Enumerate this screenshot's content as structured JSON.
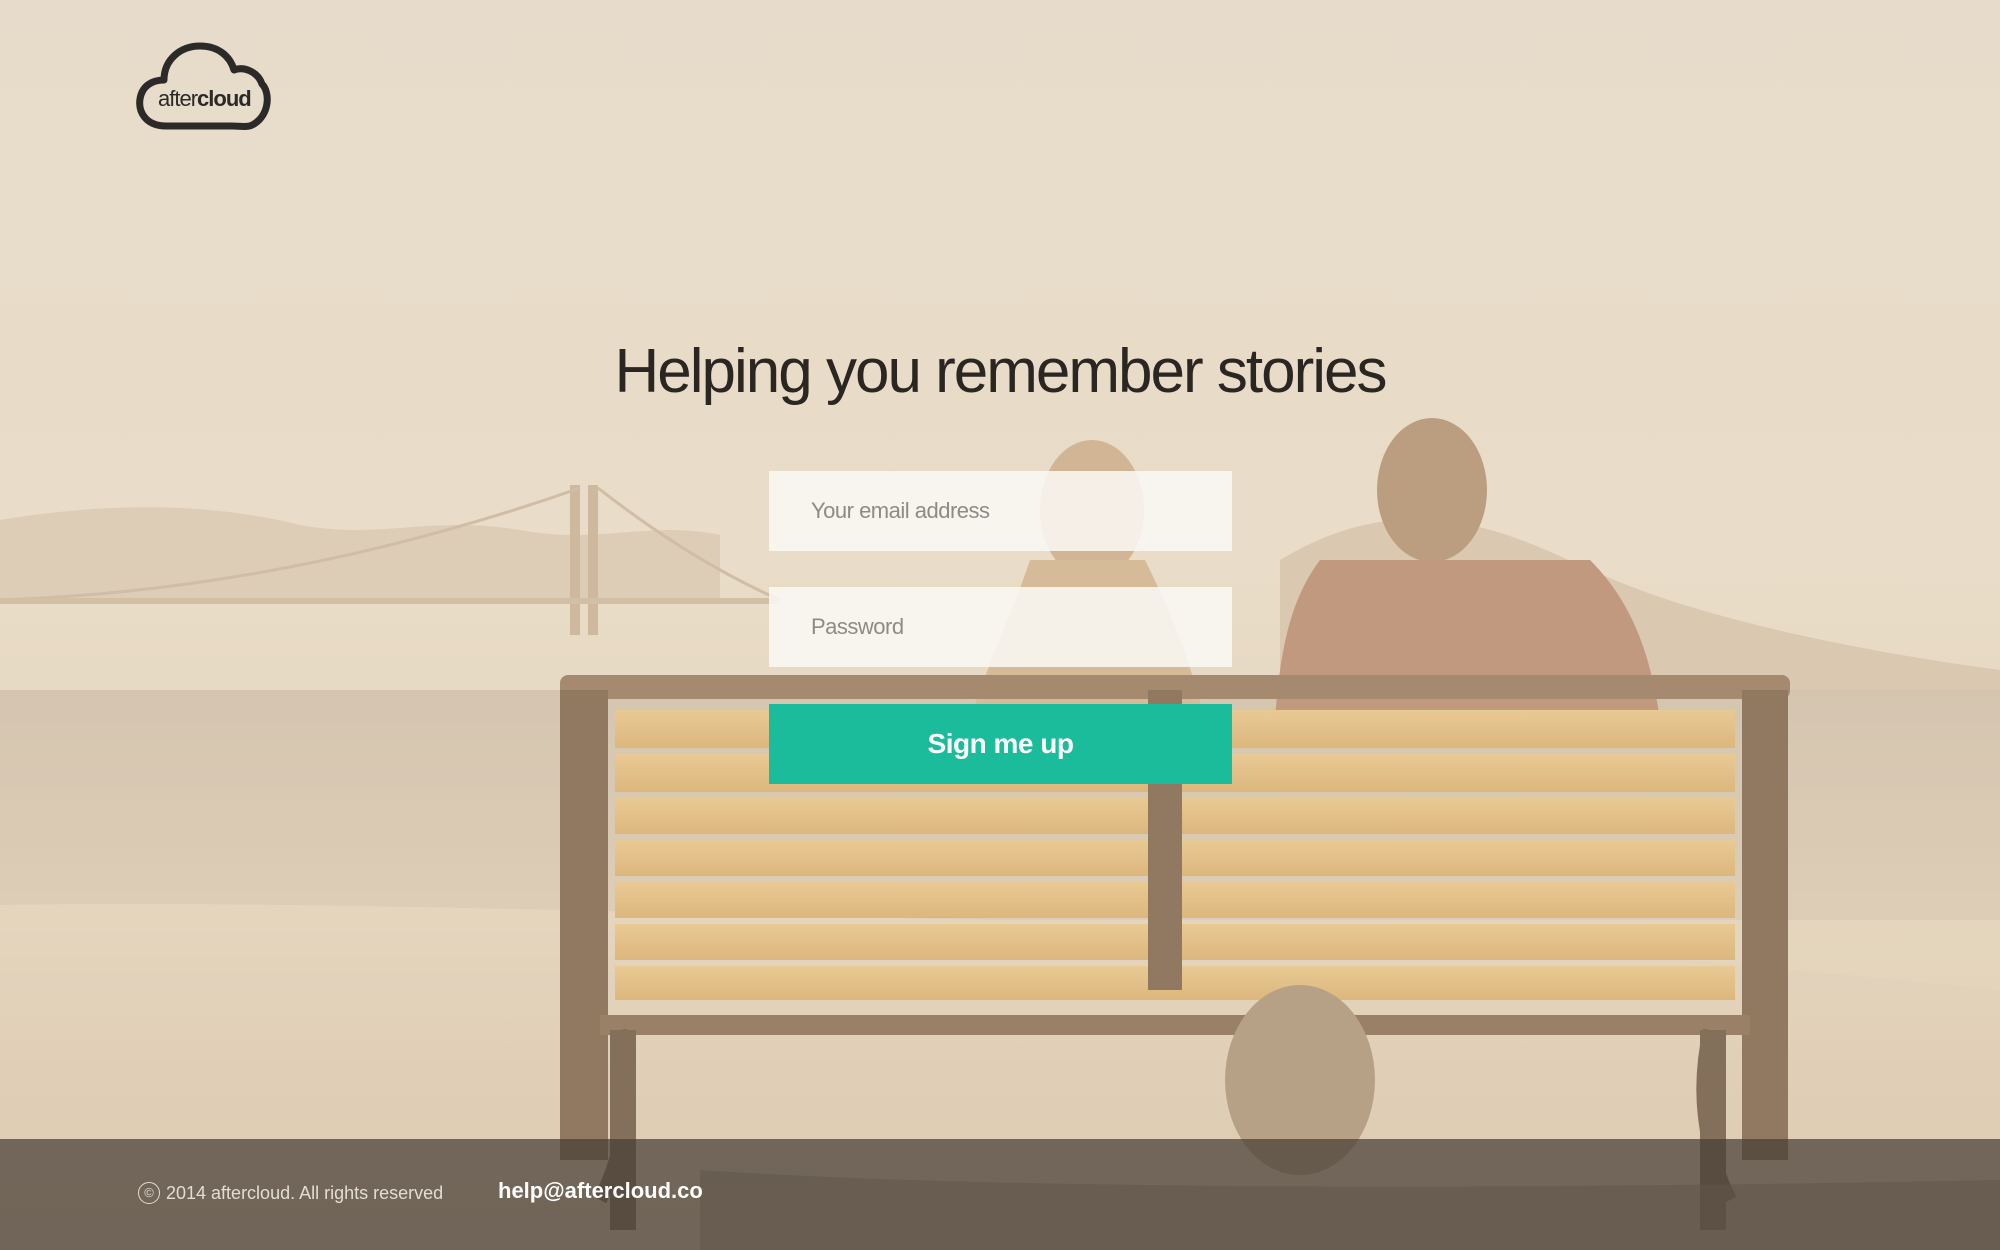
{
  "brand": {
    "logo_light": "after",
    "logo_bold": "cloud"
  },
  "hero": {
    "headline": "Helping you remember stories"
  },
  "form": {
    "email_placeholder": "Your email address",
    "password_placeholder": "Password",
    "submit_label": "Sign me up"
  },
  "footer": {
    "copyright_symbol": "©",
    "copyright_text": "2014 aftercloud. All rights reserved",
    "contact_email": "help@aftercloud.co"
  },
  "colors": {
    "accent": "#1abc9c",
    "headline": "#2b2622",
    "footer_bg": "#463e36",
    "background_tone": "#e6d8c4"
  },
  "icons": {
    "logo": "cloud-logo-icon",
    "copyright": "copyright-icon"
  }
}
